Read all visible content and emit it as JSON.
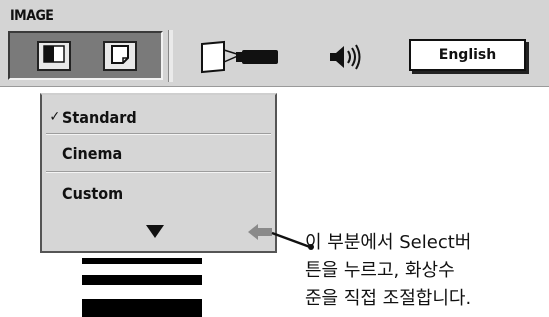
{
  "menu_bar": {
    "title": "IMAGE",
    "icons": [
      "image-level-icon",
      "image-adjust-icon",
      "projector-icon",
      "volume-icon"
    ],
    "language_label": "English"
  },
  "image_level_menu": {
    "items": [
      {
        "label": "Standard",
        "checked": true
      },
      {
        "label": "Cinema",
        "checked": false
      },
      {
        "label": "Custom",
        "checked": false
      }
    ],
    "check_mark": "✓",
    "icons": [
      "scroll-down-arrow-icon",
      "back-arrow-icon"
    ]
  },
  "annotation": {
    "lines": [
      "이 부분에서 Select버",
      "튼을 누르고, 화상수",
      "준을 직접 조절합니다."
    ]
  }
}
